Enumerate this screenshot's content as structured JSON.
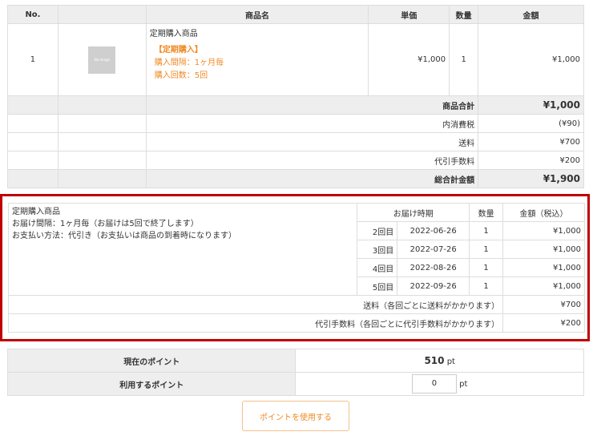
{
  "order": {
    "headers": {
      "no": "No.",
      "image": "",
      "name": "商品名",
      "price": "単価",
      "qty": "数量",
      "amount": "金額"
    },
    "item": {
      "no": "1",
      "image_alt": "No Image",
      "name": "定期購入商品",
      "tag": "【定期購入】",
      "interval": "購入間隔：1ヶ月毎",
      "count": "購入回数：5回",
      "price": "¥1,000",
      "qty": "1",
      "amount": "¥1,000"
    },
    "summary": [
      {
        "label": "商品合計",
        "value": "¥1,000"
      },
      {
        "label": "内消費税",
        "value": "(¥90)"
      },
      {
        "label": "送料",
        "value": "¥700"
      },
      {
        "label": "代引手数料",
        "value": "¥200"
      },
      {
        "label": "総合計金額",
        "value": "¥1,900"
      }
    ]
  },
  "subscription": {
    "product": "定期購入商品",
    "delivery": "お届け間隔：1ヶ月毎（お届けは5回で終了します）",
    "payment": "お支払い方法：代引き（お支払いは商品の到着時になります）",
    "headers": {
      "timing": "お届け時期",
      "qty": "数量",
      "amount": "金額（税込）"
    },
    "rows": [
      {
        "round": "2回目",
        "date": "2022-06-26",
        "qty": "1",
        "amount": "¥1,000"
      },
      {
        "round": "3回目",
        "date": "2022-07-26",
        "qty": "1",
        "amount": "¥1,000"
      },
      {
        "round": "4回目",
        "date": "2022-08-26",
        "qty": "1",
        "amount": "¥1,000"
      },
      {
        "round": "5回目",
        "date": "2022-09-26",
        "qty": "1",
        "amount": "¥1,000"
      }
    ],
    "shipping_label": "送料（各回ごとに送料がかかります）",
    "shipping_value": "¥700",
    "cod_label": "代引手数料（各回ごとに代引手数料がかかります）",
    "cod_value": "¥200"
  },
  "points": {
    "current_label": "現在のポイント",
    "current_value": "510",
    "unit": "pt",
    "use_label": "利用するポイント",
    "use_value": "0",
    "button": "ポイントを使用する"
  }
}
